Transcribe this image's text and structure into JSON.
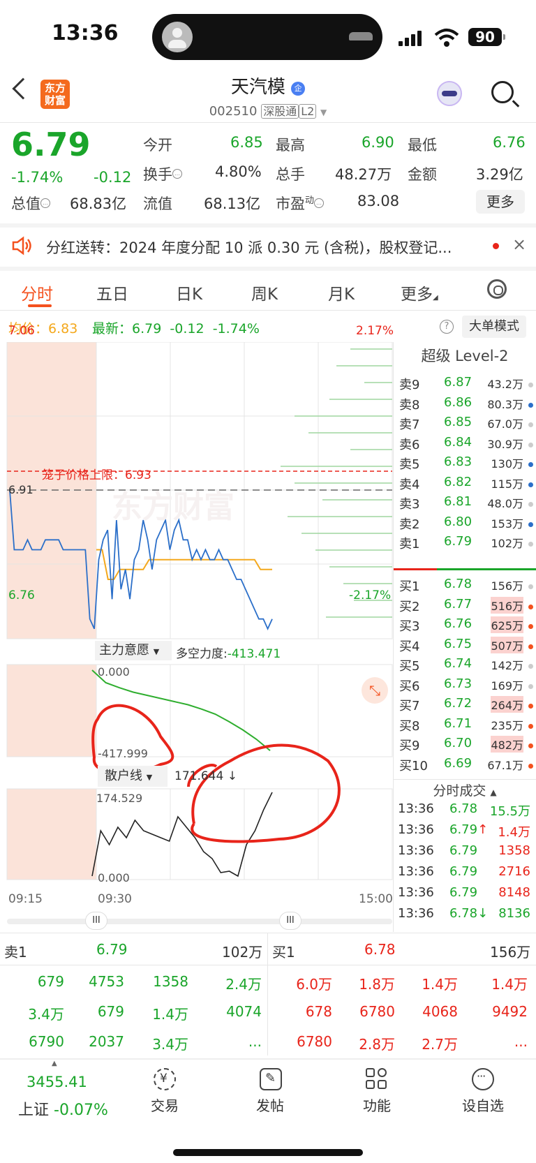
{
  "status_bar": {
    "time": "13:36",
    "battery": "90"
  },
  "header": {
    "logo": "东方财富",
    "stock_name": "天汽模",
    "qi_badge": "企",
    "code": "002510",
    "tag1": "深股通",
    "tag2": "L2"
  },
  "quote": {
    "price": "6.79",
    "pct": "-1.74%",
    "chg": "-0.12",
    "open_label": "今开",
    "open": "6.85",
    "high_label": "最高",
    "high": "6.90",
    "low_label": "最低",
    "low": "6.76",
    "turnover_label": "换手",
    "turnover": "4.80%",
    "vol_label": "总手",
    "vol": "48.27万",
    "amt_label": "金额",
    "amt": "3.29亿",
    "mcap_label": "总值",
    "mcap": "68.83亿",
    "float_label": "流值",
    "float": "68.13亿",
    "pe_label": "市盈",
    "pe_sup": "动",
    "pe": "83.08",
    "more": "更多"
  },
  "notice": {
    "text": "分红送转：2024 年度分配 10 派 0.30 元 (含税)，股权登记..."
  },
  "tabs": [
    "分时",
    "五日",
    "日K",
    "周K",
    "月K",
    "更多"
  ],
  "quote_line": {
    "avg_label": "均价：",
    "avg": "6.83",
    "last_label": "最新：",
    "last": "6.79",
    "chg": "-0.12",
    "pct": "-1.74%",
    "mode_btn": "大单模式",
    "help": "?"
  },
  "chart": {
    "y_high": "7.06",
    "y_low": "6.76",
    "pct_high": "2.17%",
    "pct_low": "-2.17%",
    "prev_close": "6.91",
    "limit_label": "笼子价格上限：6.93",
    "watermark": "东方财富",
    "ind1_name": "主力意愿",
    "ind1_extra_label": "多空力度:",
    "ind1_extra": "-413.471",
    "ind1_top": "0.000",
    "ind1_bottom": "-417.999",
    "ind2_name": "散户线",
    "ind2_extra": "171.644 ↓",
    "ind2_top": "174.529",
    "ind2_bottom": "0.000",
    "x_start": "09:15",
    "x_mid": "09:30",
    "x_end": "15:00",
    "handle": "III"
  },
  "chart_data": {
    "type": "line",
    "x_range": [
      "09:15",
      "15:00"
    ],
    "y_range": [
      6.76,
      7.06
    ],
    "prev_close": 6.91,
    "limit_price": 6.93,
    "series": [
      {
        "values": [
          6.91,
          6.85,
          6.85,
          6.85,
          6.86,
          6.85,
          6.85,
          6.85,
          6.86,
          6.86,
          6.86,
          6.86,
          6.85,
          6.85,
          6.85,
          6.85,
          6.85,
          6.85,
          6.78,
          6.77,
          6.84,
          6.86,
          6.87,
          6.8,
          6.88,
          6.81,
          6.83,
          6.8,
          6.84,
          6.85,
          6.88,
          6.86,
          6.83,
          6.86,
          6.87,
          6.88,
          6.85,
          6.87,
          6.88,
          6.86,
          6.86,
          6.84,
          6.85,
          6.84,
          6.85,
          6.84,
          6.84,
          6.85,
          6.84,
          6.84,
          6.83,
          6.82,
          6.82,
          6.81,
          6.8,
          6.79,
          6.78,
          6.78,
          6.77,
          6.78
        ]
      },
      {
        "values": [
          6.85,
          6.85,
          6.82,
          6.82,
          6.83,
          6.83,
          6.83,
          6.83,
          6.83,
          6.84,
          6.84,
          6.84,
          6.84,
          6.84,
          6.84,
          6.84,
          6.84,
          6.84,
          6.84,
          6.84,
          6.84,
          6.84,
          6.84,
          6.84,
          6.84,
          6.84,
          6.84,
          6.84,
          6.83,
          6.83,
          6.83
        ]
      }
    ]
  },
  "orderbook": {
    "title": "超级 Level-2",
    "asks": [
      {
        "l": "卖9",
        "p": "6.87",
        "v": "43.2万"
      },
      {
        "l": "卖8",
        "p": "6.86",
        "v": "80.3万"
      },
      {
        "l": "卖7",
        "p": "6.85",
        "v": "67.0万"
      },
      {
        "l": "卖6",
        "p": "6.84",
        "v": "30.9万"
      },
      {
        "l": "卖5",
        "p": "6.83",
        "v": "130万"
      },
      {
        "l": "卖4",
        "p": "6.82",
        "v": "115万"
      },
      {
        "l": "卖3",
        "p": "6.81",
        "v": "48.0万"
      },
      {
        "l": "卖2",
        "p": "6.80",
        "v": "153万"
      },
      {
        "l": "卖1",
        "p": "6.79",
        "v": "102万"
      }
    ],
    "bids": [
      {
        "l": "买1",
        "p": "6.78",
        "v": "156万"
      },
      {
        "l": "买2",
        "p": "6.77",
        "v": "516万"
      },
      {
        "l": "买3",
        "p": "6.76",
        "v": "625万"
      },
      {
        "l": "买4",
        "p": "6.75",
        "v": "507万"
      },
      {
        "l": "买5",
        "p": "6.74",
        "v": "142万"
      },
      {
        "l": "买6",
        "p": "6.73",
        "v": "169万"
      },
      {
        "l": "买7",
        "p": "6.72",
        "v": "264万"
      },
      {
        "l": "买8",
        "p": "6.71",
        "v": "235万"
      },
      {
        "l": "买9",
        "p": "6.70",
        "v": "482万"
      },
      {
        "l": "买10",
        "p": "6.69",
        "v": "67.1万"
      }
    ]
  },
  "ticks": {
    "title": "分时成交",
    "rows": [
      {
        "t": "13:36",
        "p": "6.78",
        "v": "15.5万"
      },
      {
        "t": "13:36",
        "p": "6.79↑",
        "v": "1.4万"
      },
      {
        "t": "13:36",
        "p": "6.79",
        "v": "1358"
      },
      {
        "t": "13:36",
        "p": "6.79",
        "v": "2716"
      },
      {
        "t": "13:36",
        "p": "6.79",
        "v": "8148"
      },
      {
        "t": "13:36",
        "p": "6.78↓",
        "v": "8136"
      }
    ]
  },
  "queue": {
    "sell_label": "卖1",
    "sell_price": "6.79",
    "sell_vol": "102万",
    "buy_label": "买1",
    "buy_price": "6.78",
    "buy_vol": "156万",
    "sell_cells": [
      "679",
      "4753",
      "1358",
      "2.4万",
      "3.4万",
      "679",
      "1.4万",
      "4074",
      "6790",
      "2037",
      "3.4万",
      "..."
    ],
    "buy_cells": [
      "6.0万",
      "1.8万",
      "1.4万",
      "1.4万",
      "678",
      "6780",
      "4068",
      "9492",
      "6780",
      "2.8万",
      "2.7万",
      "..."
    ]
  },
  "bottom": {
    "index_value": "3455.41",
    "index_name": "上证",
    "index_pct": "-0.07%",
    "trade": "交易",
    "post": "发帖",
    "func": "功能",
    "watch": "设自选"
  }
}
